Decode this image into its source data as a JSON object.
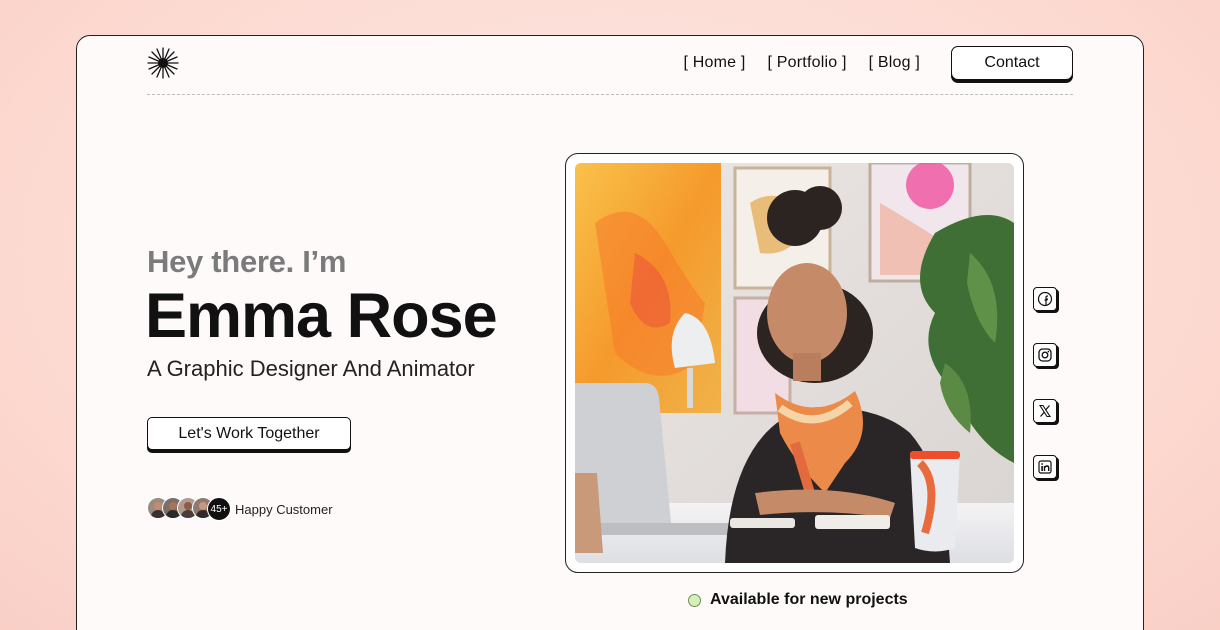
{
  "nav": {
    "links": [
      "[ Home ]",
      "[ Portfolio ]",
      "[ Blog ]"
    ],
    "contact_label": "Contact"
  },
  "hero": {
    "greeting": "Hey there. I’m",
    "name": "Emma Rose",
    "role": "A Graphic Designer And Animator",
    "cta_label": "Let's Work Together",
    "customers_count": "45+",
    "customers_label": "Happy Customer",
    "availability": "Available for new projects"
  },
  "icons": {
    "logo": "starburst-icon",
    "socials": [
      "facebook-icon",
      "instagram-icon",
      "x-icon",
      "linkedin-icon"
    ]
  },
  "colors": {
    "page_background": "#fcd9d0",
    "card_background": "#fffafa",
    "text": "#111111",
    "greeting": "#7b7b7b",
    "available_dot": "#d6f0b5"
  }
}
